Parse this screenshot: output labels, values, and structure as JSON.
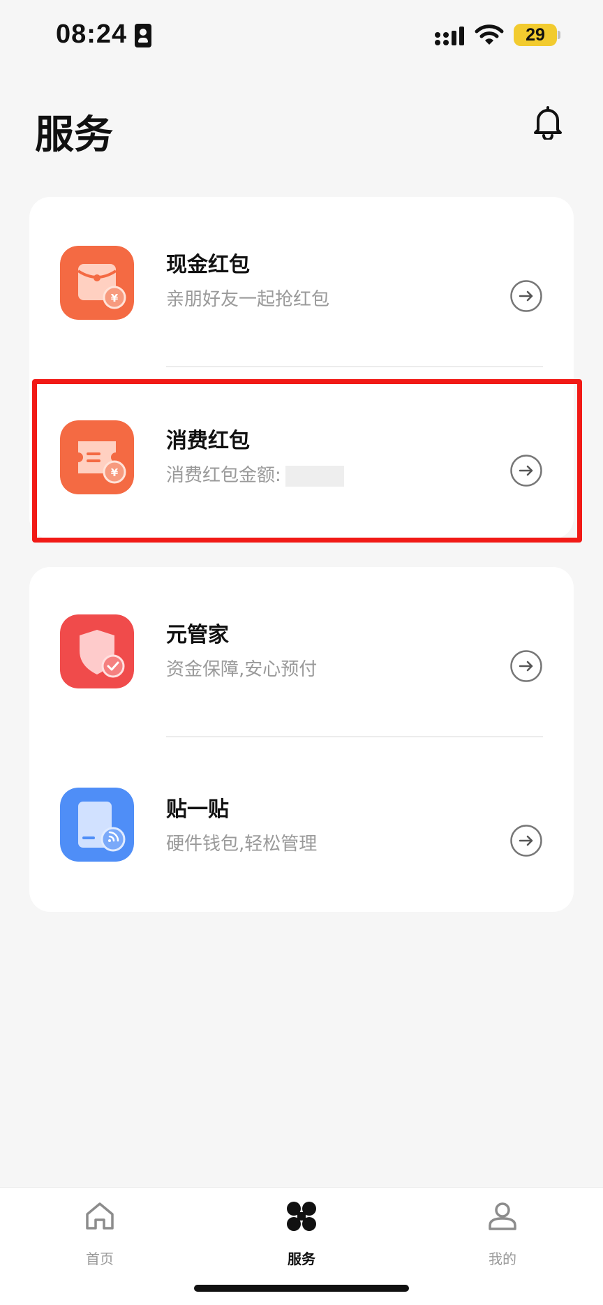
{
  "status_bar": {
    "time": "08:24",
    "battery": "29"
  },
  "header": {
    "title": "服务"
  },
  "cards": [
    {
      "items": [
        {
          "title": "现金红包",
          "subtitle": "亲朋好友一起抢红包",
          "icon": "red-envelope-icon"
        },
        {
          "title": "消费红包",
          "subtitle": "消费红包金额:",
          "icon": "coupon-icon"
        }
      ]
    },
    {
      "items": [
        {
          "title": "元管家",
          "subtitle": "资金保障,安心预付",
          "icon": "shield-check-icon"
        },
        {
          "title": "贴一贴",
          "subtitle": "硬件钱包,轻松管理",
          "icon": "nfc-card-icon"
        }
      ]
    }
  ],
  "tabbar": {
    "tabs": [
      {
        "label": "首页",
        "icon": "home-icon"
      },
      {
        "label": "服务",
        "icon": "grid-icon",
        "active": true
      },
      {
        "label": "我的",
        "icon": "user-icon"
      }
    ]
  },
  "colors": {
    "orange_icon": "#f46a43",
    "red_icon": "#f04b4b",
    "blue_icon": "#4f8ef7",
    "highlight": "#f11a16",
    "background": "#f6f6f6"
  }
}
